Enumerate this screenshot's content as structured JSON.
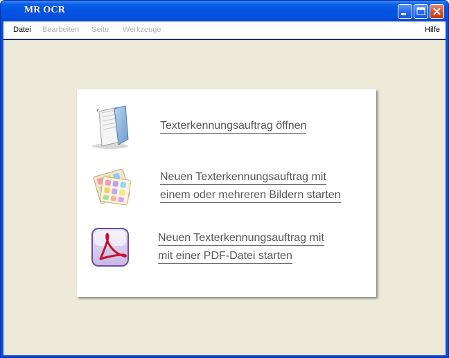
{
  "window": {
    "title": "MR OCR"
  },
  "menu": {
    "items": [
      {
        "label": "Datei",
        "enabled": true
      },
      {
        "label": "Bearbeiten",
        "enabled": false
      },
      {
        "label": "Seite",
        "enabled": false
      },
      {
        "label": "Werkzeuge",
        "enabled": false
      }
    ],
    "help": {
      "label": "Hilfe",
      "enabled": true
    }
  },
  "actions": [
    {
      "icon": "folder-icon",
      "lines": [
        "Texterkennungsauftrag öffnen"
      ]
    },
    {
      "icon": "images-icon",
      "lines": [
        "Neuen Texterkennungsauftrag mit",
        "einem oder mehreren Bildern starten"
      ]
    },
    {
      "icon": "pdf-icon",
      "lines": [
        "Neuen Texterkennungsauftrag mit",
        "mit einer PDF-Datei starten"
      ]
    }
  ],
  "colors": {
    "titlebar": "#0454e3",
    "client_background": "#ece9d8",
    "panel": "#ffffff",
    "link_text": "#555555"
  }
}
